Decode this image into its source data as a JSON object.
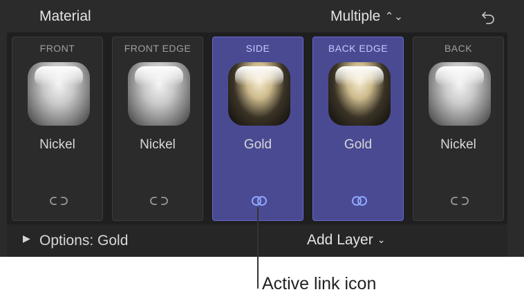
{
  "header": {
    "title": "Material",
    "multiple_label": "Multiple",
    "multiple_chevron": "⌃⌄",
    "reset_icon": "undo-icon"
  },
  "layers": [
    {
      "label": "FRONT",
      "material": "Nickel",
      "link_state": "unlinked",
      "selected": false
    },
    {
      "label": "FRONT EDGE",
      "material": "Nickel",
      "link_state": "unlinked",
      "selected": false
    },
    {
      "label": "SIDE",
      "material": "Gold",
      "link_state": "linked",
      "selected": true
    },
    {
      "label": "BACK EDGE",
      "material": "Gold",
      "link_state": "linked",
      "selected": true
    },
    {
      "label": "BACK",
      "material": "Nickel",
      "link_state": "unlinked",
      "selected": false
    }
  ],
  "footer": {
    "options_arrow": "▶",
    "options_label": "Options: Gold",
    "add_layer_label": "Add Layer",
    "add_layer_chevron": "⌄"
  },
  "callout": {
    "text": "Active link icon"
  },
  "colors": {
    "panel_bg": "#2b2b2b",
    "selected_bg": "#4a4a93",
    "active_link": "#8fa8ff",
    "inactive_link": "#9a9a9a"
  }
}
